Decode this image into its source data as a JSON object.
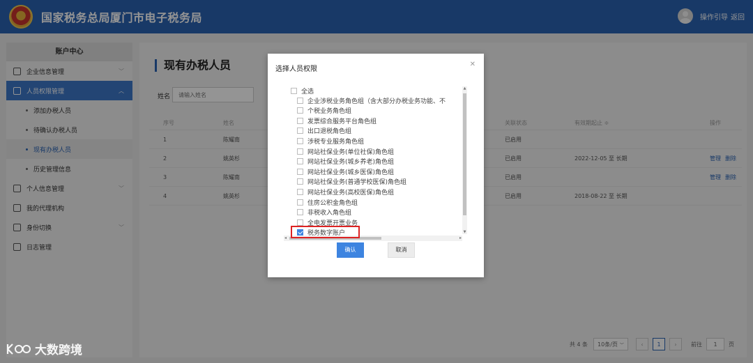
{
  "header": {
    "title": "国家税务总局厦门市电子税务局",
    "guide_label": "操作引导",
    "back_label": "返回"
  },
  "sidebar": {
    "title": "账户中心",
    "items": [
      {
        "label": "企业信息管理"
      },
      {
        "label": "人员权限管理"
      },
      {
        "label": "个人信息管理"
      },
      {
        "label": "我的代理机构"
      },
      {
        "label": "身份切换"
      },
      {
        "label": "日志管理"
      }
    ],
    "sub_items": [
      {
        "label": "添加办税人员"
      },
      {
        "label": "待确认办税人员"
      },
      {
        "label": "现有办税人员"
      },
      {
        "label": "历史管理信息"
      }
    ]
  },
  "main": {
    "page_title": "现有办税人员",
    "search_label": "姓名",
    "search_placeholder": "请输入姓名",
    "columns": [
      "序号",
      "姓名",
      "关联状态",
      "有效期起止 ≑",
      "操作"
    ],
    "rows": [
      {
        "no": "1",
        "name": "陈耀南",
        "status": "已启用",
        "period": "",
        "ops": []
      },
      {
        "no": "2",
        "name": "姚英杉",
        "status": "已启用",
        "period": "2022-12-05 至 长期",
        "ops": [
          "管理",
          "删除"
        ]
      },
      {
        "no": "3",
        "name": "陈耀南",
        "status": "已启用",
        "period": "",
        "ops": [
          "管理",
          "删除"
        ]
      },
      {
        "no": "4",
        "name": "姚英杉",
        "status": "已启用",
        "period": "2018-08-22 至 长期",
        "ops": []
      }
    ],
    "pager": {
      "total": "共 4 条",
      "page_size": "10条/页",
      "current_page": "1",
      "goto_prefix": "前往",
      "goto_value": "1",
      "goto_suffix": "页"
    }
  },
  "modal": {
    "title": "选择人员权限",
    "select_all": "全选",
    "roles": [
      {
        "label": "企业涉税业务角色组（含大部分办税业务功能、不",
        "checked": false
      },
      {
        "label": "个税业务角色组",
        "checked": false
      },
      {
        "label": "发票综合服务平台角色组",
        "checked": false
      },
      {
        "label": "出口退税角色组",
        "checked": false
      },
      {
        "label": "涉税专业服务角色组",
        "checked": false
      },
      {
        "label": "网站社保业务(单位社保)角色组",
        "checked": false
      },
      {
        "label": "网站社保业务(城乡养老)角色组",
        "checked": false
      },
      {
        "label": "网站社保业务(城乡医保)角色组",
        "checked": false
      },
      {
        "label": "网站社保业务(普通学校医保)角色组",
        "checked": false
      },
      {
        "label": "网站社保业务(高校医保)角色组",
        "checked": false
      },
      {
        "label": "住房公积金角色组",
        "checked": false
      },
      {
        "label": "非税收入角色组",
        "checked": false
      },
      {
        "label": "全电发票开票业务",
        "checked": false
      },
      {
        "label": "税务数字账户",
        "checked": true
      }
    ],
    "confirm_label": "确认",
    "cancel_label": "取消"
  },
  "watermark": {
    "text": "大数跨境"
  },
  "colors": {
    "header_bg": "#2a62b2",
    "accent": "#3d84e0",
    "highlight": "#dd2222"
  }
}
